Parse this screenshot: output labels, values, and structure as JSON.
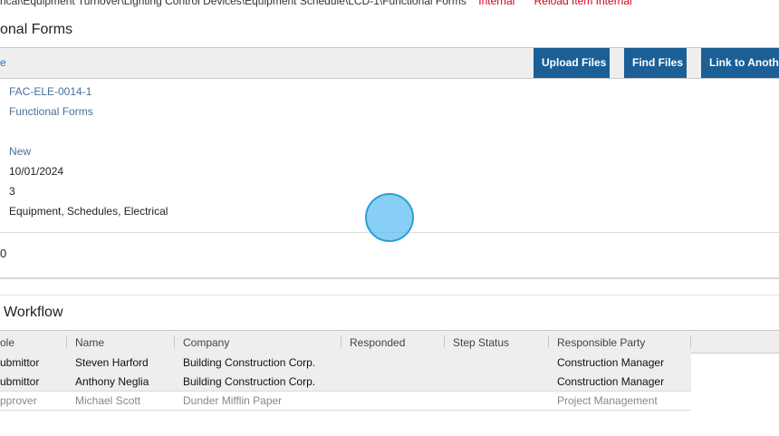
{
  "breadcrumb": {
    "path": "rical\\Equipment Turnover\\Lighting Control Devices\\Equipment Schedule\\LCD-1\\Functional Forms",
    "internal_link": "Internal",
    "reload_link": "Reload Item Internal"
  },
  "section1": {
    "title": "onal Forms",
    "toolbar_link": "e",
    "buttons": {
      "upload": "Upload Files",
      "find": "Find Files",
      "link_to": "Link to Anothe"
    },
    "fields": {
      "id": "FAC-ELE-0014-1",
      "type": "Functional Forms",
      "status": "New",
      "date": "10/01/2024",
      "count": "3",
      "tags": "Equipment, Schedules, Electrical"
    },
    "footer_value": "0"
  },
  "workflow": {
    "title": "Workflow",
    "columns": [
      "ole",
      "Name",
      "Company",
      "Responded",
      "Step Status",
      "Responsible Party"
    ],
    "rows": [
      {
        "role": "ubmittor",
        "name": "Steven Harford",
        "company": "Building Construction Corp.",
        "responded": "",
        "step_status": "",
        "party": "Construction Manager"
      },
      {
        "role": "ubmittor",
        "name": "Anthony Neglia",
        "company": "Building Construction Corp.",
        "responded": "",
        "step_status": "",
        "party": "Construction Manager"
      },
      {
        "role": "pprover",
        "name": "Michael Scott",
        "company": "Dunder Mifflin Paper",
        "responded": "",
        "step_status": "",
        "party": "Project Management"
      }
    ]
  },
  "colors": {
    "accent_button": "#1b5f96",
    "link_red": "#d0021b",
    "link_blue": "#4a6f95",
    "cursor": "#54baf0"
  }
}
